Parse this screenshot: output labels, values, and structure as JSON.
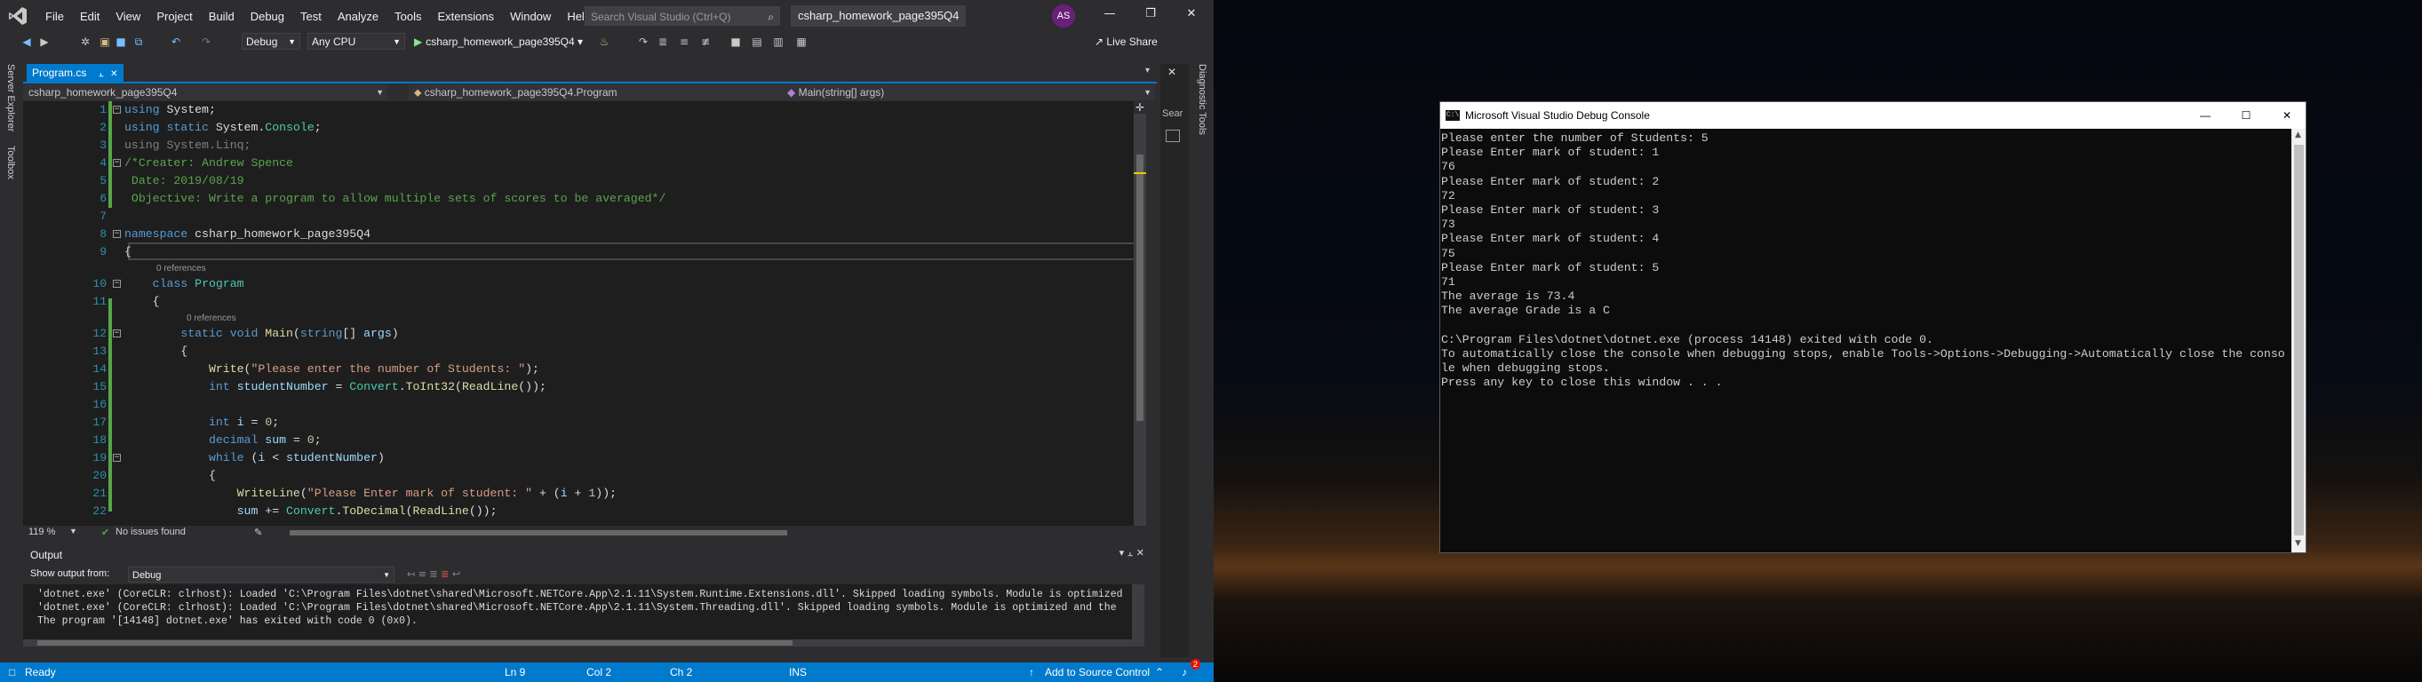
{
  "vs": {
    "menu": [
      "File",
      "Edit",
      "View",
      "Project",
      "Build",
      "Debug",
      "Test",
      "Analyze",
      "Tools",
      "Extensions",
      "Window",
      "Help"
    ],
    "search_placeholder": "Search Visual Studio (Ctrl+Q)",
    "solution_name": "csharp_homework_page395Q4",
    "avatar_initials": "AS",
    "toolbar": {
      "config": "Debug",
      "platform": "Any CPU",
      "run_target": "csharp_homework_page395Q4",
      "live_share": "Live Share"
    },
    "left_tabs": [
      "Server Explorer",
      "Toolbox"
    ],
    "right_tabs": [
      "Diagnostic Tools"
    ],
    "side_panel_text": "Sear",
    "tab": {
      "name": "Program.cs"
    },
    "nav": {
      "project": "csharp_homework_page395Q4",
      "class": "csharp_homework_page395Q4.Program",
      "member": "Main(string[] args)"
    },
    "code_lines": [
      {
        "n": "1",
        "parts": [
          [
            "kw",
            "using"
          ],
          [
            "pl",
            " System;"
          ]
        ]
      },
      {
        "n": "2",
        "parts": [
          [
            "kw",
            "using static"
          ],
          [
            "pl",
            " System."
          ],
          [
            "ty",
            "Console"
          ],
          [
            "pl",
            ";"
          ]
        ]
      },
      {
        "n": "3",
        "parts": [
          [
            "gr",
            "using System.Linq;"
          ]
        ]
      },
      {
        "n": "4",
        "parts": [
          [
            "cm",
            "/*Creater: Andrew Spence"
          ]
        ]
      },
      {
        "n": "5",
        "parts": [
          [
            "cm",
            " Date: 2019/08/19"
          ]
        ]
      },
      {
        "n": "6",
        "parts": [
          [
            "cm",
            " Objective: Write a program to allow multiple sets of scores to be averaged*/"
          ]
        ]
      },
      {
        "n": "7",
        "parts": []
      },
      {
        "n": "8",
        "parts": [
          [
            "kw",
            "namespace"
          ],
          [
            "pl",
            " csharp_homework_page395Q4"
          ]
        ]
      },
      {
        "n": "9",
        "parts": [
          [
            "pl",
            "{"
          ]
        ]
      },
      {
        "n": "10",
        "parts": [
          [
            "pl",
            "    "
          ],
          [
            "kw",
            "class"
          ],
          [
            "pl",
            " "
          ],
          [
            "ty",
            "Program"
          ]
        ]
      },
      {
        "n": "11",
        "parts": [
          [
            "pl",
            "    {"
          ]
        ]
      },
      {
        "n": "12",
        "parts": [
          [
            "pl",
            "        "
          ],
          [
            "kw",
            "static void"
          ],
          [
            "pl",
            " "
          ],
          [
            "mt",
            "Main"
          ],
          [
            "pl",
            "("
          ],
          [
            "kw",
            "string"
          ],
          [
            "pl",
            "[] "
          ],
          [
            "lv",
            "args"
          ],
          [
            "pl",
            ")"
          ]
        ]
      },
      {
        "n": "13",
        "parts": [
          [
            "pl",
            "        {"
          ]
        ]
      },
      {
        "n": "14",
        "parts": [
          [
            "pl",
            "            "
          ],
          [
            "mt",
            "Write"
          ],
          [
            "pl",
            "("
          ],
          [
            "st",
            "\"Please enter the number of Students: \""
          ],
          [
            "pl",
            ");"
          ]
        ]
      },
      {
        "n": "15",
        "parts": [
          [
            "pl",
            "            "
          ],
          [
            "kw",
            "int"
          ],
          [
            "pl",
            " "
          ],
          [
            "lv",
            "studentNumber"
          ],
          [
            "pl",
            " = "
          ],
          [
            "ty",
            "Convert"
          ],
          [
            "pl",
            "."
          ],
          [
            "mt",
            "ToInt32"
          ],
          [
            "pl",
            "("
          ],
          [
            "mt",
            "ReadLine"
          ],
          [
            "pl",
            "());"
          ]
        ]
      },
      {
        "n": "16",
        "parts": []
      },
      {
        "n": "17",
        "parts": [
          [
            "pl",
            "            "
          ],
          [
            "kw",
            "int"
          ],
          [
            "pl",
            " "
          ],
          [
            "lv",
            "i"
          ],
          [
            "pl",
            " = "
          ],
          [
            "nu",
            "0"
          ],
          [
            "pl",
            ";"
          ]
        ]
      },
      {
        "n": "18",
        "parts": [
          [
            "pl",
            "            "
          ],
          [
            "kw",
            "decimal"
          ],
          [
            "pl",
            " "
          ],
          [
            "lv",
            "sum"
          ],
          [
            "pl",
            " = "
          ],
          [
            "nu",
            "0"
          ],
          [
            "pl",
            ";"
          ]
        ]
      },
      {
        "n": "19",
        "parts": [
          [
            "pl",
            "            "
          ],
          [
            "kw",
            "while"
          ],
          [
            "pl",
            " ("
          ],
          [
            "lv",
            "i"
          ],
          [
            "pl",
            " < "
          ],
          [
            "lv",
            "studentNumber"
          ],
          [
            "pl",
            ")"
          ]
        ]
      },
      {
        "n": "20",
        "parts": [
          [
            "pl",
            "            {"
          ]
        ]
      },
      {
        "n": "21",
        "parts": [
          [
            "pl",
            "                "
          ],
          [
            "mt",
            "WriteLine"
          ],
          [
            "pl",
            "("
          ],
          [
            "st",
            "\"Please Enter mark of student: \""
          ],
          [
            "pl",
            " + ("
          ],
          [
            "lv",
            "i"
          ],
          [
            "pl",
            " + "
          ],
          [
            "nu",
            "1"
          ],
          [
            "pl",
            "));"
          ]
        ]
      },
      {
        "n": "22",
        "parts": [
          [
            "pl",
            "                "
          ],
          [
            "lv",
            "sum"
          ],
          [
            "pl",
            " += "
          ],
          [
            "ty",
            "Convert"
          ],
          [
            "pl",
            "."
          ],
          [
            "mt",
            "ToDecimal"
          ],
          [
            "pl",
            "("
          ],
          [
            "mt",
            "ReadLine"
          ],
          [
            "pl",
            "());"
          ]
        ]
      }
    ],
    "refs_label": "0 references",
    "editor_status": {
      "zoom": "119 %",
      "issues": "No issues found"
    },
    "output": {
      "title": "Output",
      "show_from_label": "Show output from:",
      "source": "Debug",
      "lines": [
        "'dotnet.exe' (CoreCLR: clrhost): Loaded 'C:\\Program Files\\dotnet\\shared\\Microsoft.NETCore.App\\2.1.11\\System.Runtime.Extensions.dll'. Skipped loading symbols. Module is optimized",
        "'dotnet.exe' (CoreCLR: clrhost): Loaded 'C:\\Program Files\\dotnet\\shared\\Microsoft.NETCore.App\\2.1.11\\System.Threading.dll'. Skipped loading symbols. Module is optimized and the",
        "The program '[14148] dotnet.exe' has exited with code 0 (0x0)."
      ]
    },
    "status": {
      "ready": "Ready",
      "ln": "Ln 9",
      "col": "Col 2",
      "ch": "Ch 2",
      "ins": "INS",
      "source_control": "Add to Source Control",
      "notif_count": "2"
    },
    "colors": {
      "accent": "#007acc",
      "editor_bg": "#1e1e1e",
      "chrome": "#2d2d30"
    }
  },
  "console": {
    "title": "Microsoft Visual Studio Debug Console",
    "icon_text": "C:\\",
    "lines": [
      "Please enter the number of Students: 5",
      "Please Enter mark of student: 1",
      "76",
      "Please Enter mark of student: 2",
      "72",
      "Please Enter mark of student: 3",
      "73",
      "Please Enter mark of student: 4",
      "75",
      "Please Enter mark of student: 5",
      "71",
      "The average is 73.4",
      "The average Grade is a C",
      "",
      "C:\\Program Files\\dotnet\\dotnet.exe (process 14148) exited with code 0.",
      "To automatically close the console when debugging stops, enable Tools->Options->Debugging->Automatically close the conso",
      "le when debugging stops.",
      "Press any key to close this window . . ."
    ]
  }
}
